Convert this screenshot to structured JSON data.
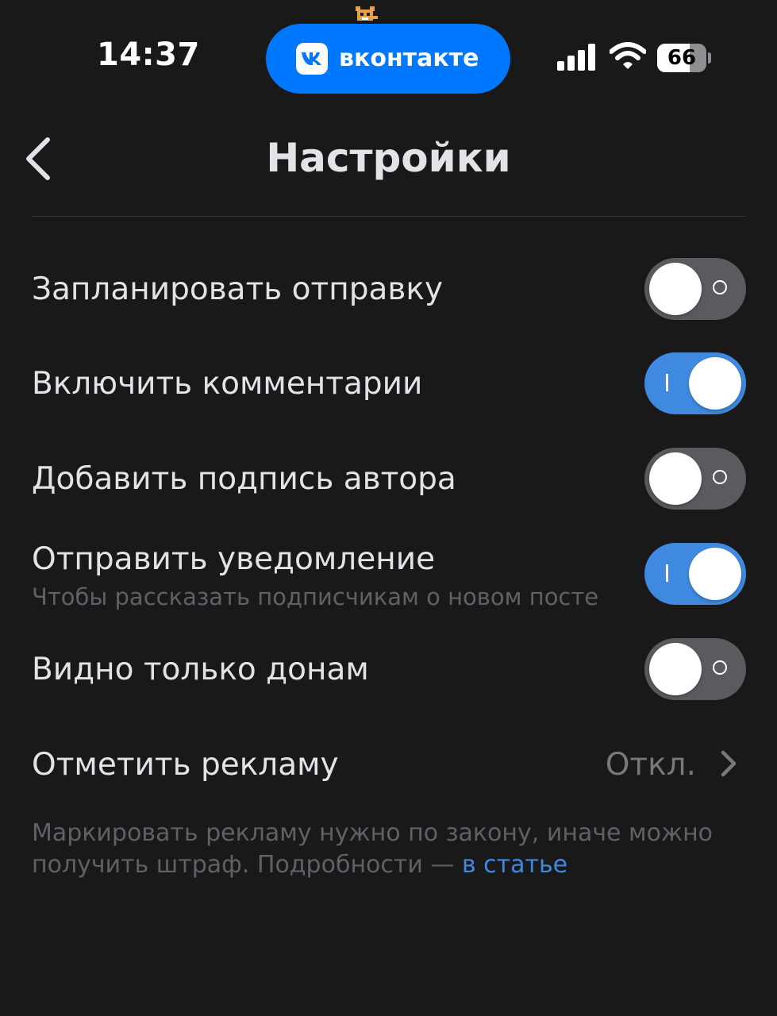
{
  "status_bar": {
    "time": "14:37",
    "island_label": "вконтакте",
    "battery_level": 66,
    "battery_text": "66",
    "icons": [
      "pet-icon",
      "vk-logo-icon",
      "signal-icon",
      "wifi-icon",
      "battery-icon"
    ]
  },
  "header": {
    "title": "Настройки",
    "back_icon": "chevron-left-icon"
  },
  "settings": [
    {
      "label": "Запланировать отправку",
      "enabled": false
    },
    {
      "label": "Включить комментарии",
      "enabled": true
    },
    {
      "label": "Добавить подпись автора",
      "enabled": false
    },
    {
      "label": "Отправить уведомление",
      "sublabel": "Чтобы рассказать подписчикам о новом посте",
      "enabled": true
    },
    {
      "label": "Видно только донам",
      "enabled": false
    }
  ],
  "ad": {
    "label": "Отметить рекламу",
    "value": "Откл.",
    "chevron_icon": "chevron-right-icon"
  },
  "footnote": {
    "text": "Маркировать рекламу нужно по закону, иначе можно получить штраф. Подробности — ",
    "link": "в статье"
  },
  "colors": {
    "background": "#19191a",
    "toggle_on": "#3f8ae0",
    "toggle_off": "#5a5b5f",
    "island": "#0077ff",
    "link": "#3f8ae0"
  }
}
